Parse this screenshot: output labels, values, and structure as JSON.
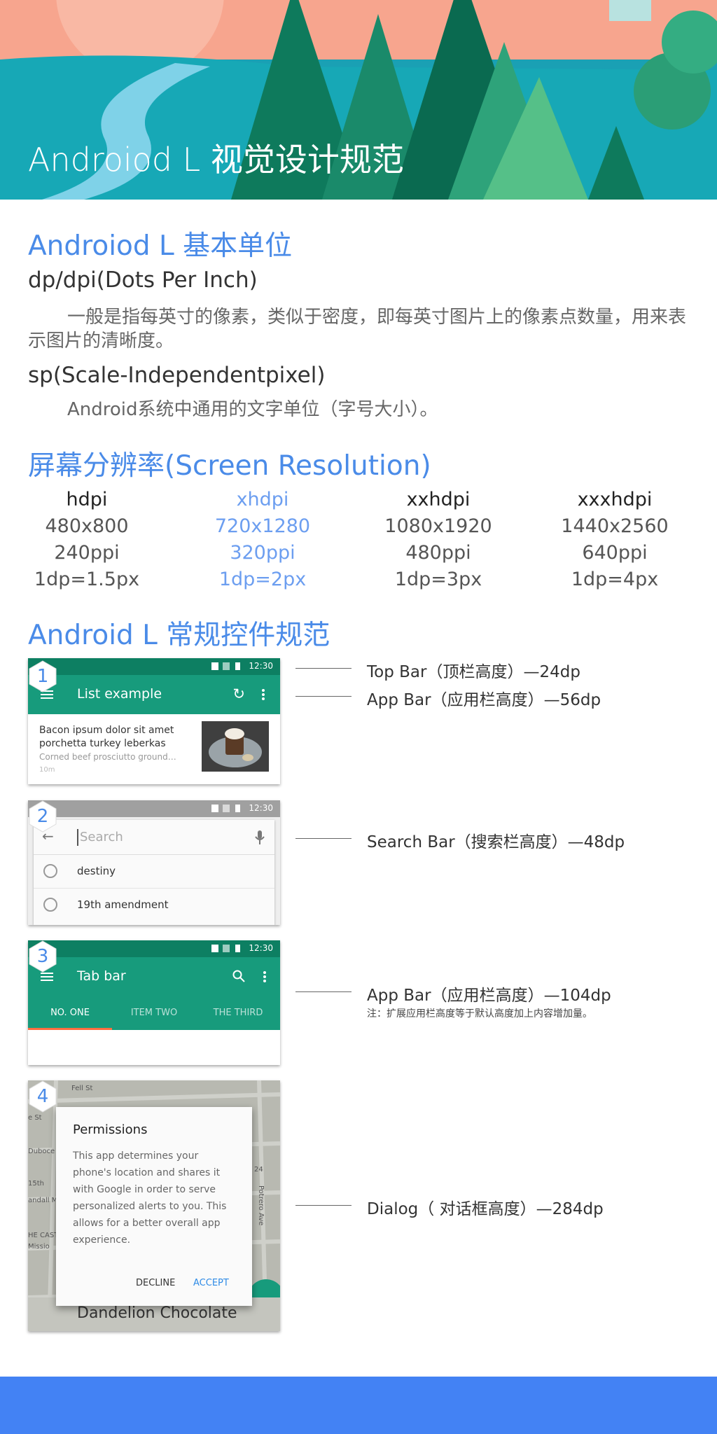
{
  "hero": {
    "title": "Androiod L  视觉设计规范"
  },
  "units": {
    "heading": "Androiod L  基本单位",
    "dp_title": "dp/dpi(Dots Per Inch)",
    "dp_desc": "一般是指每英寸的像素，类似于密度，即每英寸图片上的像素点数量，用来表示图片的清晰度。",
    "sp_title": "sp(Scale-Independentpixel)",
    "sp_desc": "Android系统中通用的文字单位（字号大小）。"
  },
  "resolution": {
    "heading": "屏幕分辨率(Screen Resolution)",
    "columns": [
      {
        "name": "hdpi",
        "size": "480x800",
        "ppi": "240ppi",
        "ratio": "1dp=1.5px",
        "highlight": false
      },
      {
        "name": "xhdpi",
        "size": "720x1280",
        "ppi": "320ppi",
        "ratio": "1dp=2px",
        "highlight": true
      },
      {
        "name": "xxhdpi",
        "size": "1080x1920",
        "ppi": "480ppi",
        "ratio": "1dp=3px",
        "highlight": false
      },
      {
        "name": "xxxhdpi",
        "size": "1440x2560",
        "ppi": "640ppi",
        "ratio": "1dp=4px",
        "highlight": false
      }
    ],
    "highlight_color": "#6c9ef0"
  },
  "controls": {
    "heading": "Android L 常规控件规范",
    "status_time": "12:30",
    "card1": {
      "badge": "1",
      "appbar_title": "List example",
      "item_title": "Bacon ipsum dolor sit amet porchetta turkey leberkas",
      "item_sub": "Corned beef prosciutto ground…",
      "item_time": "10m"
    },
    "card2": {
      "badge": "2",
      "search_placeholder": "Search",
      "suggestions": [
        "destiny",
        "19th amendment"
      ]
    },
    "card3": {
      "badge": "3",
      "appbar_title": "Tab bar",
      "tabs": [
        "NO. ONE",
        "ITEM TWO",
        "THE THIRD"
      ]
    },
    "card4": {
      "badge": "4",
      "dialog_title": "Permissions",
      "dialog_body": "This app determines your phone's location and shares it with Google in order to serve personalized alerts to you. This allows for a better overall app experience.",
      "decline": "DECLINE",
      "accept": "ACCEPT",
      "map_caption": "Dandelion Chocolate",
      "map_labels": [
        "Fell St",
        "e St",
        "Duboce",
        "15th",
        "andall M",
        "HE CAST",
        "Missio",
        "24",
        "Potrero Ave"
      ]
    },
    "annotations": {
      "top_bar": "Top Bar（顶栏高度）—24dp",
      "app_bar": "App Bar（应用栏高度）—56dp",
      "search_bar": "Search Bar（搜索栏高度）—48dp",
      "app_bar_ext": "App Bar（应用栏高度）—104dp",
      "app_bar_ext_note": "注：扩展应用栏高度等于默认高度加上内容增加量。",
      "dialog": "Dialog（ 对话框高度）—284dp"
    },
    "accent_color": "#179b7c",
    "heading_color": "#4a8be8"
  },
  "footer": {
    "color": "#4382f4"
  }
}
